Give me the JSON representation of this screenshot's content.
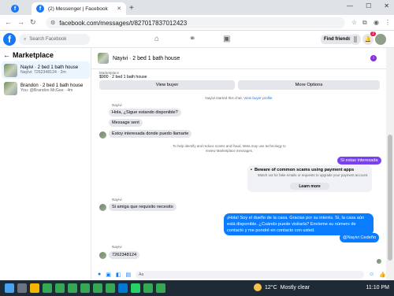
{
  "browser": {
    "tab_title": "(2) Messenger | Facebook",
    "new_tab_label": "+",
    "url": "facebook.com/messages/t/827017837012423"
  },
  "facebook": {
    "logo_letter": "f",
    "search_placeholder": "Search Facebook",
    "find_friends": "Find friends",
    "notif_count": "2"
  },
  "sidebar": {
    "title": "Marketplace",
    "conversations": [
      {
        "title": "Nayivi · 2 bed 1 bath house",
        "subtitle": "Nayivi: 7262348124 · 2m"
      },
      {
        "title": "Brandon · 2 bed 1 bath house",
        "subtitle": "You: @Brandon McGee · 4m"
      }
    ]
  },
  "chat": {
    "name": "Nayivi · 2 bed 1 bath house",
    "listing_label": "Marketplace",
    "listing_price": "$900 · 2 bed 1 bath house",
    "view_buyer": "View buyer",
    "more_options": "More Options",
    "started_text": "Nayivi started this chat.",
    "view_buyer_profile": "View buyer profile",
    "sender_name": "Nayivi",
    "msg1": "Hola, ¿Sigue estando disponible?",
    "msg2": "Message sent",
    "msg3": "Estoy interesada donde puedo llamarte",
    "scam_note": "To help identify and reduce scams and fraud, Meta may use technology to review Marketplace messages.",
    "msg_out1": "Si estas interesada",
    "warn_title": "Beware of common scams using payment apps",
    "warn_body": "Watch out for fake emails or requests to upgrade your payment account.",
    "learn_more": "Learn more",
    "msg4": "Si amiga que requisito necesito",
    "msg_out2": "¡Hola! Soy el dueño de la casa. Gracias por su interés. Sí, la casa aún está disponible. ¿Cuándo puede visitarla? Envíeme su número de contacto y me pondré en contacto con usted.",
    "msg_out3": "@Nayivi Cedeño",
    "msg5": "7262348124",
    "composer_placeholder": "Aa"
  },
  "taskbar": {
    "temperature": "12°C",
    "weather": "Mostly clear",
    "time": "11:10 PM"
  }
}
